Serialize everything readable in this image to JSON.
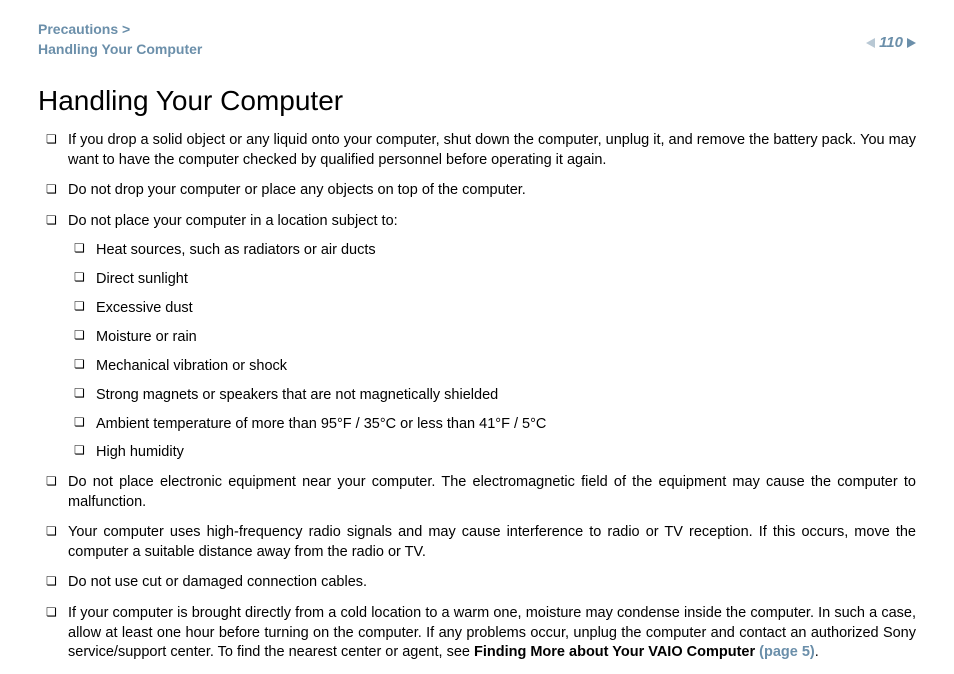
{
  "breadcrumb": {
    "line1": "Precautions >",
    "line2": "Handling Your Computer"
  },
  "page_number": "110",
  "title": "Handling Your Computer",
  "items": [
    {
      "text": "If you drop a solid object or any liquid onto your computer, shut down the computer, unplug it, and remove the battery pack. You may want to have the computer checked by qualified personnel before operating it again."
    },
    {
      "text": "Do not drop your computer or place any objects on top of the computer."
    },
    {
      "text": "Do not place your computer in a location subject to:",
      "sub": [
        "Heat sources, such as radiators or air ducts",
        "Direct sunlight",
        "Excessive dust",
        "Moisture or rain",
        "Mechanical vibration or shock",
        "Strong magnets or speakers that are not magnetically shielded",
        "Ambient temperature of more than 95°F / 35°C or less than 41°F / 5°C",
        "High humidity"
      ]
    },
    {
      "text": "Do not place electronic equipment near your computer. The electromagnetic field of the equipment may cause the computer to malfunction."
    },
    {
      "text": "Your computer uses high-frequency radio signals and may cause interference to radio or TV reception. If this occurs, move the computer a suitable distance away from the radio or TV."
    },
    {
      "text": "Do not use cut or damaged connection cables."
    },
    {
      "text_pre": "If your computer is brought directly from a cold location to a warm one, moisture may condense inside the computer. In such a case, allow at least one hour before turning on the computer. If any problems occur, unplug the computer and contact an authorized Sony service/support center. To find the nearest center or agent, see ",
      "bold": "Finding More about Your VAIO Computer ",
      "link": "(page 5)",
      "text_post": "."
    }
  ]
}
